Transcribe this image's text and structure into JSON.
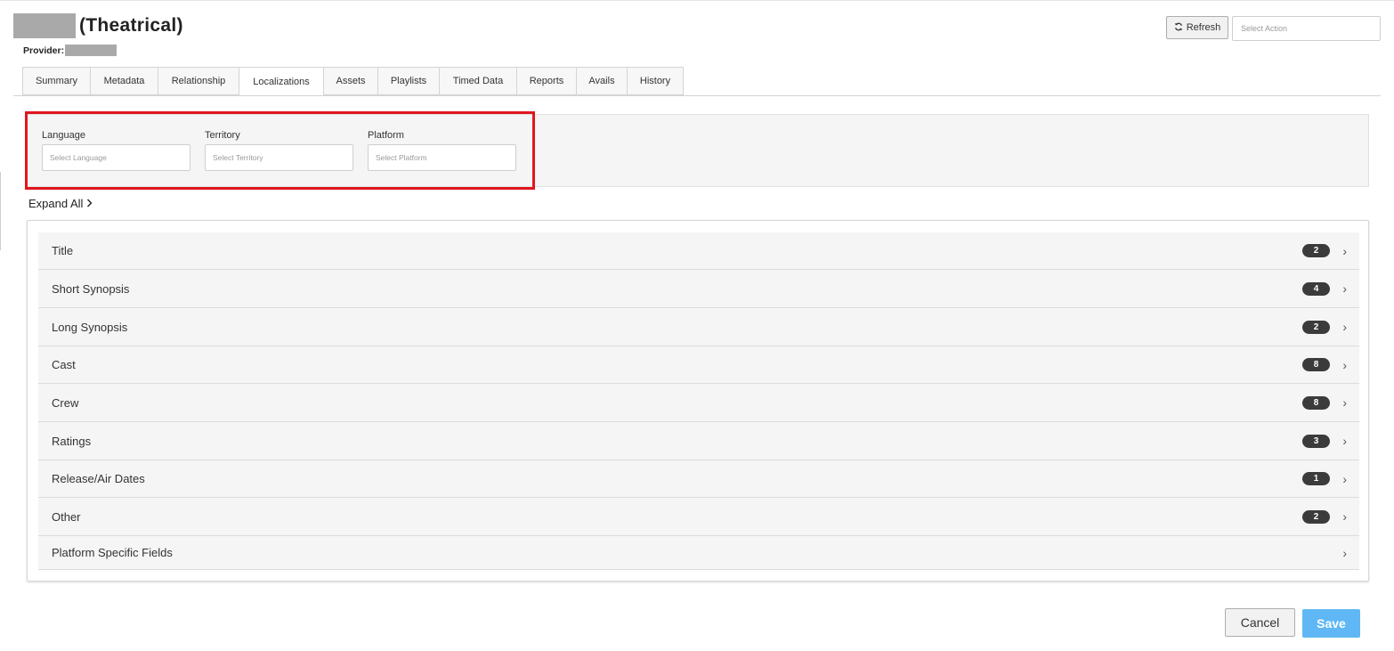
{
  "header": {
    "title_suffix": "(Theatrical)",
    "provider_label": "Provider:"
  },
  "toolbar": {
    "refresh_label": "Refresh",
    "action_placeholder": "Select Action"
  },
  "tabs": [
    {
      "label": "Summary"
    },
    {
      "label": "Metadata"
    },
    {
      "label": "Relationship"
    },
    {
      "label": "Localizations",
      "active": true
    },
    {
      "label": "Assets"
    },
    {
      "label": "Playlists"
    },
    {
      "label": "Timed Data"
    },
    {
      "label": "Reports"
    },
    {
      "label": "Avails"
    },
    {
      "label": "History"
    }
  ],
  "filters": {
    "language": {
      "label": "Language",
      "placeholder": "Select Language"
    },
    "territory": {
      "label": "Territory",
      "placeholder": "Select Territory"
    },
    "platform": {
      "label": "Platform",
      "placeholder": "Select Platform"
    }
  },
  "expand_all_label": "Expand All",
  "sections": [
    {
      "label": "Title",
      "count": "2"
    },
    {
      "label": "Short Synopsis",
      "count": "4"
    },
    {
      "label": "Long Synopsis",
      "count": "2"
    },
    {
      "label": "Cast",
      "count": "8"
    },
    {
      "label": "Crew",
      "count": "8"
    },
    {
      "label": "Ratings",
      "count": "3"
    },
    {
      "label": "Release/Air Dates",
      "count": "1"
    },
    {
      "label": "Other",
      "count": "2"
    },
    {
      "label": "Platform Specific Fields",
      "count": ""
    }
  ],
  "footer": {
    "cancel_label": "Cancel",
    "save_label": "Save"
  },
  "colors": {
    "highlight_border": "#e0161e",
    "save_button": "#5fb8f5",
    "badge": "#3b3b3b"
  }
}
